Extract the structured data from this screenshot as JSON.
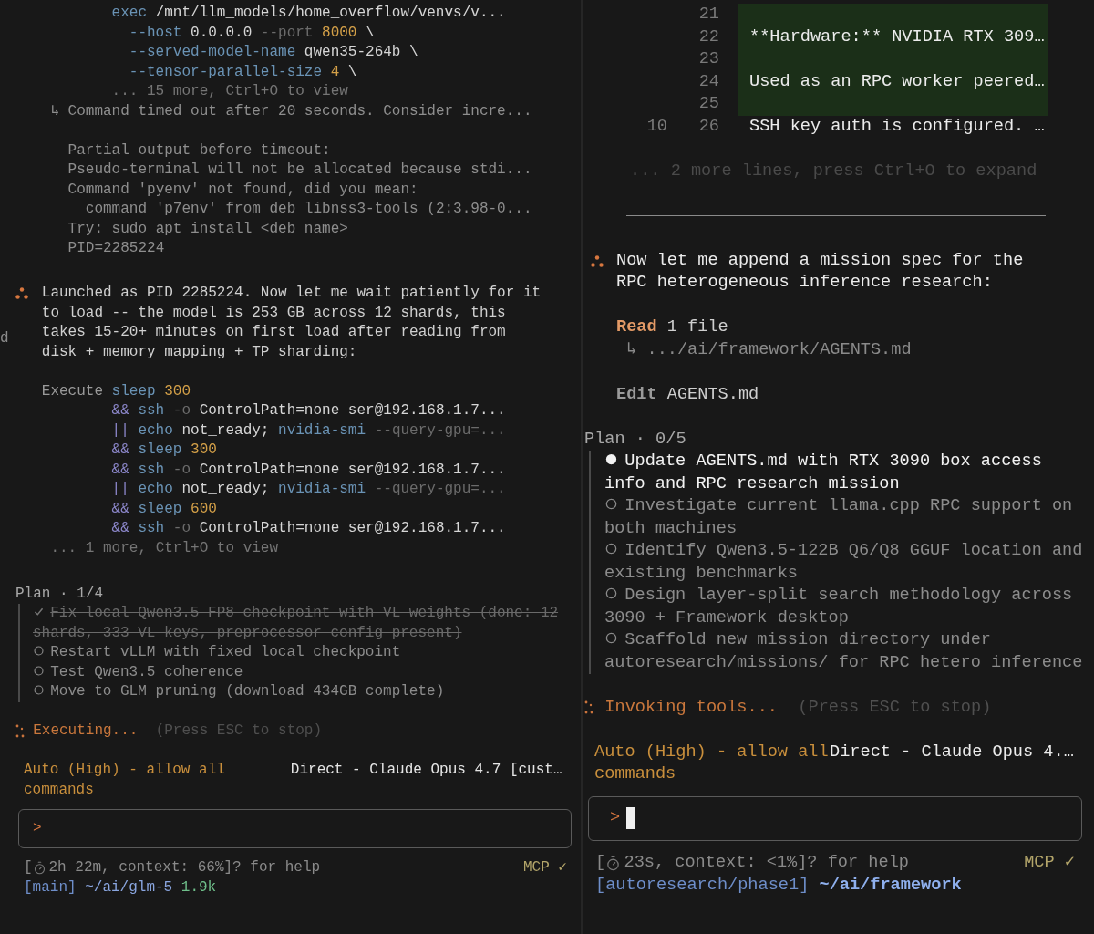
{
  "left_pane": {
    "command_preview": {
      "lines": [
        [
          {
            "text": "exec",
            "kind": "cmd"
          },
          {
            "text": " /mnt/llm_models/home_overflow/venvs/v...",
            "kind": "arg"
          }
        ],
        [
          {
            "text": "--host",
            "kind": "flag"
          },
          {
            "text": " 0.0.0.0 ",
            "kind": "arg"
          },
          {
            "text": "--port",
            "kind": "dim"
          },
          {
            "text": " 8000",
            "kind": "num"
          },
          {
            "text": " \\",
            "kind": "arg"
          }
        ],
        [
          {
            "text": "--served-model-name",
            "kind": "flag"
          },
          {
            "text": " qwen35-264b \\",
            "kind": "arg"
          }
        ],
        [
          {
            "text": "--tensor-parallel-size",
            "kind": "flag"
          },
          {
            "text": " 4",
            "kind": "num"
          },
          {
            "text": " \\",
            "kind": "arg"
          }
        ]
      ],
      "more": "... 15 more, Ctrl+O to view"
    },
    "result": {
      "marker": "↳",
      "summary": "Command timed out after 20 seconds. Consider incre...",
      "output": [
        {
          "text": "Partial output before timeout:",
          "kind": "line"
        },
        {
          "text": "Pseudo-terminal will not be allocated because stdi...",
          "kind": "line"
        },
        {
          "text": "Command 'pyenv' not found, did you mean:",
          "kind": "line"
        },
        {
          "text": "command 'p7env' from deb libnss3-tools (2:3.98-0...",
          "kind": "nested"
        },
        {
          "text": "Try: sudo apt install <deb name>",
          "kind": "line"
        },
        {
          "text": "PID=2285224",
          "kind": "line"
        }
      ]
    },
    "edge_fragment": "d",
    "message": "Launched as PID 2285224. Now let me wait patiently for it to load -- the model is 253 GB across 12 shards, this takes 15-20+ minutes on first load after reading from disk + memory mapping + TP sharding:",
    "tool_call": {
      "label": "Execute",
      "lines": [
        [
          {
            "text": "sleep",
            "kind": "cmd"
          },
          {
            "text": " 300",
            "kind": "num"
          }
        ],
        [
          {
            "text": "&&",
            "kind": "op"
          },
          {
            "text": " ssh",
            "kind": "cmd"
          },
          {
            "text": " -o",
            "kind": "dim"
          },
          {
            "text": " ControlPath=none ser@192.168.1.7...",
            "kind": "arg"
          }
        ],
        [
          {
            "text": "||",
            "kind": "op"
          },
          {
            "text": " echo",
            "kind": "cmd"
          },
          {
            "text": " not_ready;",
            "kind": "arg"
          },
          {
            "text": " nvidia-smi",
            "kind": "cmd"
          },
          {
            "text": " --query-gpu=...",
            "kind": "dim"
          }
        ],
        [
          {
            "text": "&&",
            "kind": "op"
          },
          {
            "text": " sleep",
            "kind": "cmd"
          },
          {
            "text": " 300",
            "kind": "num"
          }
        ],
        [
          {
            "text": "&&",
            "kind": "op"
          },
          {
            "text": " ssh",
            "kind": "cmd"
          },
          {
            "text": " -o",
            "kind": "dim"
          },
          {
            "text": " ControlPath=none ser@192.168.1.7...",
            "kind": "arg"
          }
        ],
        [
          {
            "text": "||",
            "kind": "op"
          },
          {
            "text": " echo",
            "kind": "cmd"
          },
          {
            "text": " not_ready;",
            "kind": "arg"
          },
          {
            "text": " nvidia-smi",
            "kind": "cmd"
          },
          {
            "text": " --query-gpu=...",
            "kind": "dim"
          }
        ],
        [
          {
            "text": "&&",
            "kind": "op"
          },
          {
            "text": " sleep",
            "kind": "cmd"
          },
          {
            "text": " 600",
            "kind": "num"
          }
        ],
        [
          {
            "text": "&&",
            "kind": "op"
          },
          {
            "text": " ssh",
            "kind": "cmd"
          },
          {
            "text": " -o",
            "kind": "dim"
          },
          {
            "text": " ControlPath=none ser@192.168.1.7...",
            "kind": "arg"
          }
        ]
      ],
      "more": "... 1 more, Ctrl+O to view"
    },
    "plan": {
      "title": "Plan · 1/4",
      "items": [
        {
          "text": "Fix local Qwen3.5 FP8 checkpoint with VL weights (done: 12 shards, 333 VL keys, preprocessor_config present)",
          "done": true,
          "current": false
        },
        {
          "text": "Restart vLLM with fixed local checkpoint",
          "done": false,
          "current": false
        },
        {
          "text": "Test Qwen3.5 coherence",
          "done": false,
          "current": false
        },
        {
          "text": "Move to GLM pruning (download 434GB complete)",
          "done": false,
          "current": false
        }
      ]
    },
    "activity": {
      "label": "Executing...",
      "hint": "(Press ESC to stop)"
    },
    "footer": {
      "mode": "Auto (High) - allow all commands",
      "model": "Direct - Claude Opus 4.7 [cust…"
    },
    "prompt": {
      "symbol": ">",
      "focused": false
    },
    "status": {
      "open": "[",
      "info": "2h 22m, context: 66%]? for help",
      "mcp": "MCP ✓",
      "branch": "[main]",
      "path": "~/ai/glm-5",
      "size": "1.9k"
    }
  },
  "right_pane": {
    "diff": {
      "rows": [
        {
          "new": "21",
          "added": true
        },
        {
          "new": "22",
          "text": "**Hardware:** NVIDIA RTX 309…",
          "added": true
        },
        {
          "new": "23",
          "added": true
        },
        {
          "new": "24",
          "text": "Used as an RPC worker peered…",
          "added": true
        },
        {
          "new": "25",
          "added": true
        },
        {
          "old": "10",
          "new": "26",
          "text": "SSH key auth is configured. …",
          "added": false
        }
      ],
      "more": "... 2 more lines, press Ctrl+O to expand"
    },
    "message": "Now let me append a mission spec for the RPC heterogeneous inference research:",
    "tools": [
      {
        "kind": "read",
        "verb": "Read",
        "target": "1 file",
        "marker": "↳",
        "detail": ".../ai/framework/AGENTS.md"
      },
      {
        "kind": "edit",
        "verb": "Edit",
        "target": "AGENTS.md"
      }
    ],
    "plan": {
      "title": "Plan · 0/5",
      "items": [
        {
          "text": "Update AGENTS.md with RTX 3090 box access info and RPC research mission",
          "done": false,
          "current": true
        },
        {
          "text": "Investigate current llama.cpp RPC support on both machines",
          "done": false,
          "current": false
        },
        {
          "text": "Identify Qwen3.5-122B Q6/Q8 GGUF location and existing benchmarks",
          "done": false,
          "current": false
        },
        {
          "text": "Design layer-split search methodology across 3090 + Framework desktop",
          "done": false,
          "current": false
        },
        {
          "text": "Scaffold new mission directory under autoresearch/missions/ for RPC hetero inference",
          "done": false,
          "current": false
        }
      ]
    },
    "activity": {
      "label": "Invoking tools...",
      "hint": "(Press ESC to stop)"
    },
    "footer": {
      "mode": "Auto (High) - allow all commands",
      "model": "Direct - Claude Opus 4.…"
    },
    "prompt": {
      "symbol": ">",
      "focused": true
    },
    "status": {
      "open": "[",
      "info": "23s, context: <1%]? for help",
      "mcp": "MCP ✓",
      "branch": "[autoresearch/phase1]",
      "path": "~/ai/framework"
    }
  }
}
